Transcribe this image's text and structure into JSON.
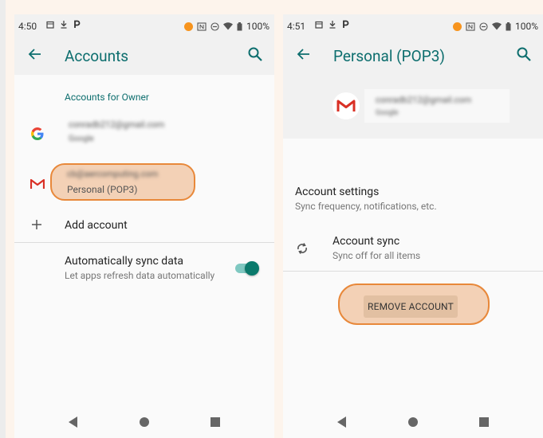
{
  "colors": {
    "accent": "#0d6e6e",
    "highlight": "#e8883a",
    "page_bg": "#fdf4ec"
  },
  "screen1": {
    "status": {
      "time": "4:50",
      "battery": "100%"
    },
    "appbar": {
      "title": "Accounts"
    },
    "section_header": "Accounts for Owner",
    "accounts": [
      {
        "icon": "google-icon",
        "email": "conradb212@gmail.com",
        "type": "Google"
      },
      {
        "icon": "gmail-icon",
        "email": "cb@aercomputing.com",
        "type": "Personal (POP3)"
      }
    ],
    "add_account": "Add account",
    "auto_sync": {
      "title": "Automatically sync data",
      "subtitle": "Let apps refresh data automatically",
      "enabled": true
    }
  },
  "screen2": {
    "status": {
      "time": "4:51",
      "battery": "100%"
    },
    "appbar": {
      "title": "Personal (POP3)"
    },
    "header": {
      "email": "conradb212@gmail.com",
      "provider": "Google"
    },
    "account_settings": {
      "title": "Account settings",
      "subtitle": "Sync frequency, notifications, etc."
    },
    "account_sync": {
      "title": "Account sync",
      "subtitle": "Sync off for all items"
    },
    "remove_button": "REMOVE ACCOUNT"
  }
}
